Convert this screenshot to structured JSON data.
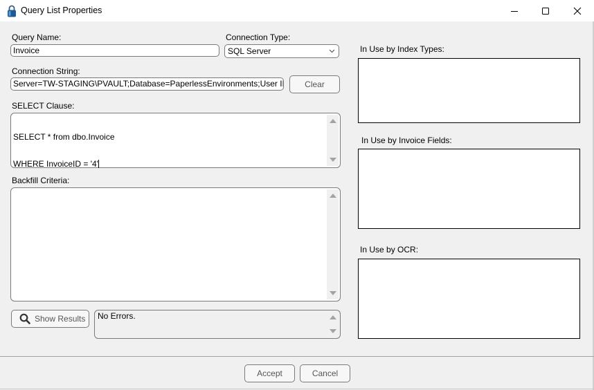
{
  "window": {
    "title": "Query List Properties",
    "icon": "padlock-icon",
    "controls": [
      "minimize",
      "maximize",
      "close"
    ]
  },
  "form": {
    "query_name": {
      "label": "Query Name:",
      "value": "Invoice"
    },
    "connection_type": {
      "label": "Connection Type:",
      "selected": "SQL Server"
    },
    "connection_string": {
      "label": "Connection String:",
      "value": "Server=TW-STAGING\\PVAULT;Database=PaperlessEnvironments;User ID=\"pva",
      "clear_label": "Clear"
    },
    "select_clause": {
      "label": "SELECT Clause:",
      "line1": "SELECT * from dbo.Invoice",
      "line2": "WHERE InvoiceID = '4'"
    },
    "backfill_criteria": {
      "label": "Backfill Criteria:",
      "value": ""
    },
    "show_results_label": "Show Results",
    "status_text": "No Errors."
  },
  "usage": {
    "index_types_label": "In Use by Index Types:",
    "invoice_fields_label": "In Use by Invoice Fields:",
    "ocr_label": "In Use by OCR:"
  },
  "footer": {
    "accept_label": "Accept",
    "cancel_label": "Cancel"
  }
}
